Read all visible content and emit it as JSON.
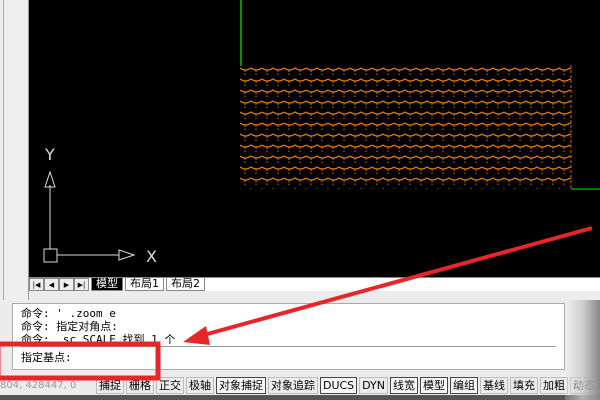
{
  "tabs": {
    "nav": [
      "|◀",
      "◀",
      "▶",
      "▶|"
    ],
    "items": [
      "模型",
      "布局1",
      "布局2"
    ]
  },
  "ucs": {
    "x_label": "X",
    "y_label": "Y"
  },
  "command": {
    "history": [
      "命令: ' .zoom  e",
      "命令: 指定对角点:",
      "命令: _sc SCALE 找到 1 个"
    ],
    "prompt": "指定基点:"
  },
  "status": {
    "coords": "804, 428447, 0",
    "buttons": [
      {
        "label": "捕捉",
        "on": false
      },
      {
        "label": "栅格",
        "on": false
      },
      {
        "label": "正交",
        "on": false
      },
      {
        "label": "极轴",
        "on": false
      },
      {
        "label": "对象捕捉",
        "on": true
      },
      {
        "label": "对象追踪",
        "on": false
      },
      {
        "label": "DUCS",
        "on": true
      },
      {
        "label": "DYN",
        "on": false
      },
      {
        "label": "线宽",
        "on": true
      },
      {
        "label": "模型",
        "on": true
      },
      {
        "label": "编组",
        "on": true
      },
      {
        "label": "基线",
        "on": false
      },
      {
        "label": "填充",
        "on": false
      },
      {
        "label": "加粗",
        "on": false
      },
      {
        "label": "动态",
        "on": false
      }
    ]
  },
  "colors": {
    "hatch": "#e07a10",
    "green": "#00c000",
    "annotation": "#e8262a"
  }
}
